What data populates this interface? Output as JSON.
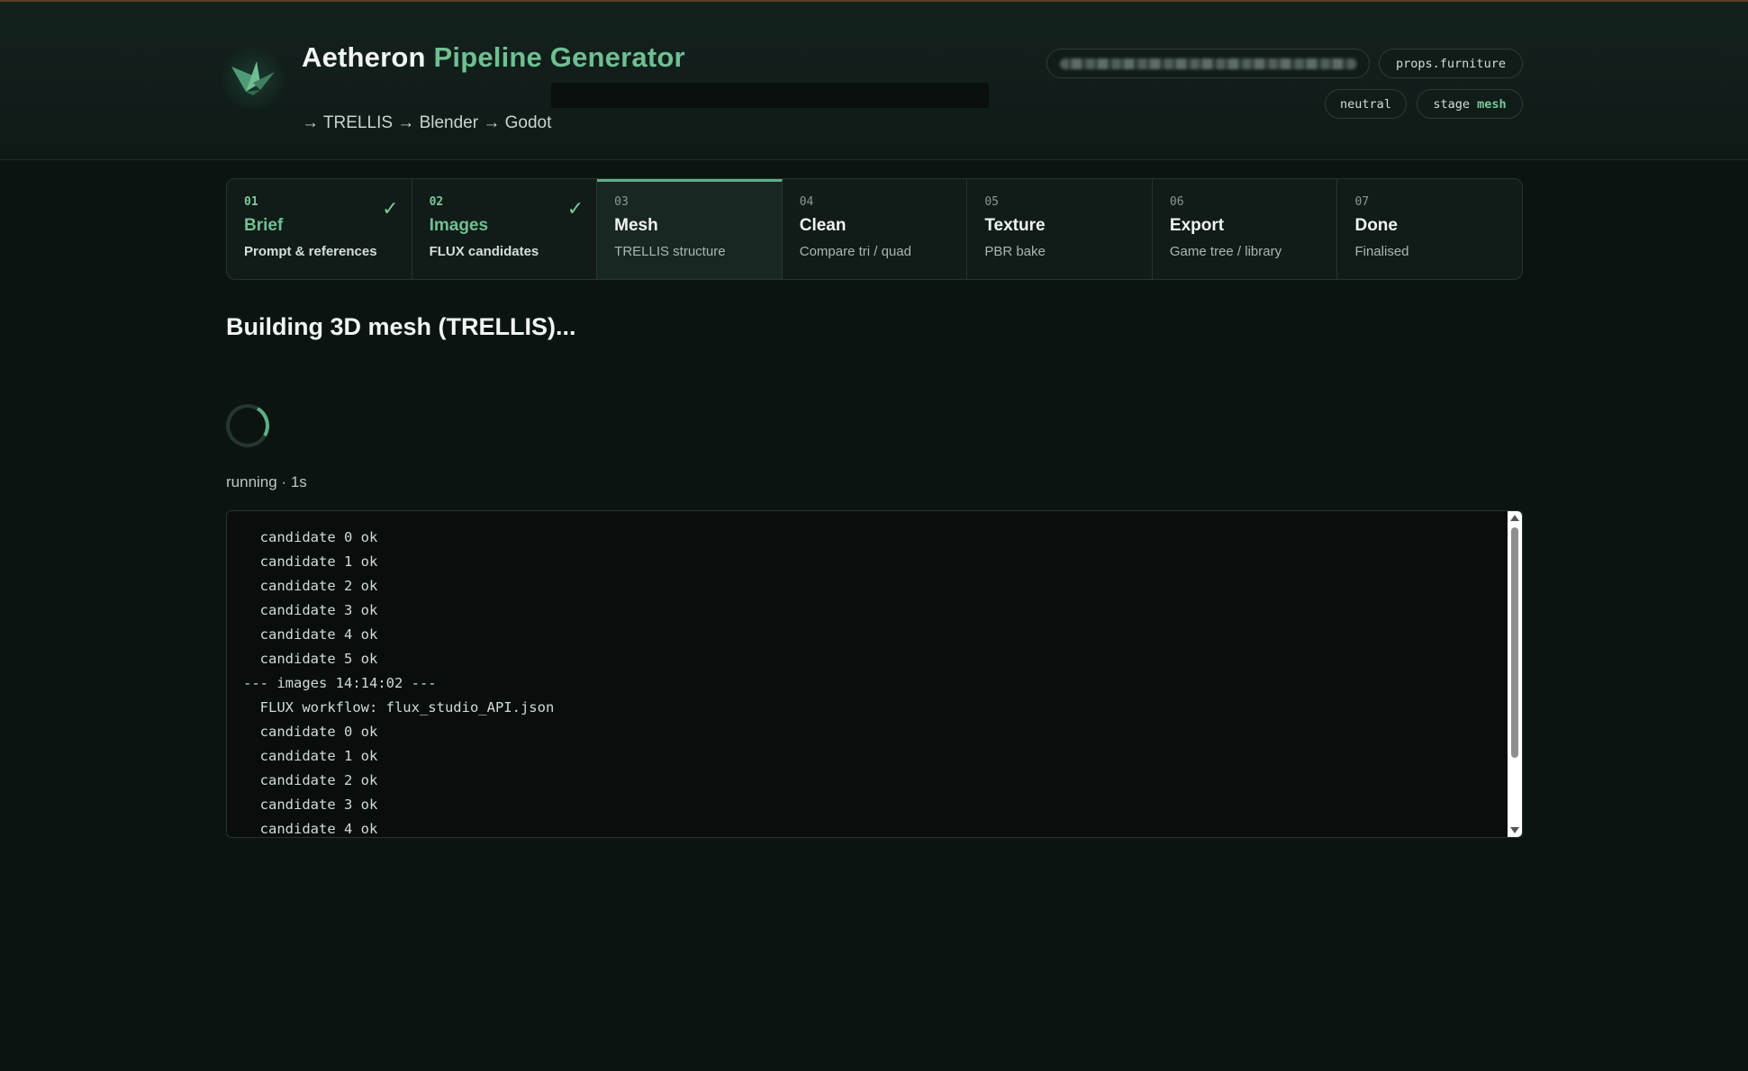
{
  "header": {
    "title_part1": "Aetheron",
    "title_part2": "Pipeline Generator",
    "subtitle": "→ TRELLIS → Blender → Godot",
    "chips": {
      "category": "props.furniture",
      "tone": "neutral",
      "stage_label": "stage",
      "stage_value": "mesh"
    }
  },
  "steps": [
    {
      "num": "01",
      "name": "Brief",
      "desc": "Prompt & references",
      "state": "done"
    },
    {
      "num": "02",
      "name": "Images",
      "desc": "FLUX candidates",
      "state": "done"
    },
    {
      "num": "03",
      "name": "Mesh",
      "desc": "TRELLIS structure",
      "state": "active"
    },
    {
      "num": "04",
      "name": "Clean",
      "desc": "Compare tri / quad",
      "state": "pending"
    },
    {
      "num": "05",
      "name": "Texture",
      "desc": "PBR bake",
      "state": "pending"
    },
    {
      "num": "06",
      "name": "Export",
      "desc": "Game tree / library",
      "state": "pending"
    },
    {
      "num": "07",
      "name": "Done",
      "desc": "Finalised",
      "state": "pending"
    }
  ],
  "check_glyph": "✓",
  "main": {
    "heading": "Building 3D mesh (TRELLIS)...",
    "status": "running · 1s"
  },
  "log": [
    "  candidate 0 ok",
    "  candidate 1 ok",
    "  candidate 2 ok",
    "  candidate 3 ok",
    "  candidate 4 ok",
    "  candidate 5 ok",
    "--- images 14:14:02 ---",
    "  FLUX workflow: flux_studio_API.json",
    "  candidate 0 ok",
    "  candidate 1 ok",
    "  candidate 2 ok",
    "  candidate 3 ok",
    "  candidate 4 ok"
  ],
  "colors": {
    "accent": "#6fbf93",
    "background": "#0c1412",
    "panel": "#111b18"
  }
}
